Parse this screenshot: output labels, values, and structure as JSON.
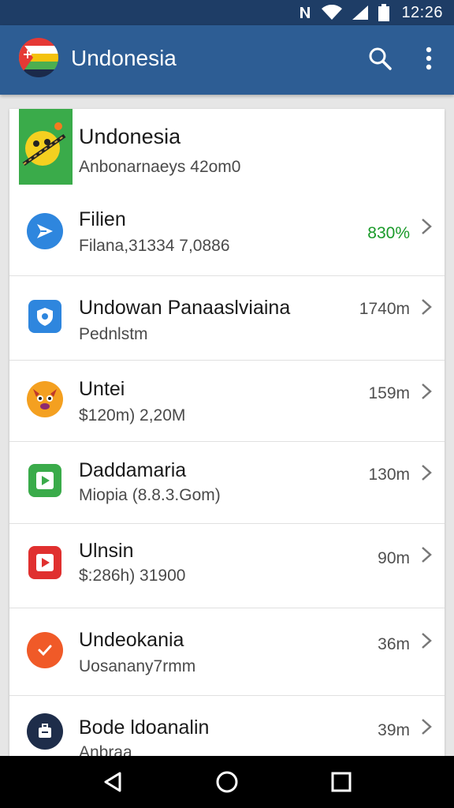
{
  "status_bar": {
    "time": "12:26",
    "icons": [
      "nfc-icon",
      "wifi-icon",
      "signal-icon",
      "battery-icon"
    ]
  },
  "app_bar": {
    "title": "Undonesia",
    "logo_icon": "flag-logo-icon",
    "actions": [
      "search-icon",
      "more-vert-icon"
    ]
  },
  "header": {
    "title": "Undonesia",
    "subtitle": "Anbonarnaeys 42om0"
  },
  "rows": [
    {
      "title": "Filien",
      "subtitle": "Filana,31334 7,0886",
      "value": "830%",
      "icon": "send-icon",
      "icon_color": "#2e86de"
    },
    {
      "title": "Undowan Panaaslviaina",
      "subtitle": "Pednlstm",
      "value": "1740m",
      "icon": "shield-icon",
      "icon_color": "#2e86de"
    },
    {
      "title": "Untei",
      "subtitle": "$120m) 2,20M",
      "value": "159m",
      "icon": "mascot-icon",
      "icon_color": "#f4a020"
    },
    {
      "title": "Daddamaria",
      "subtitle": "Miopia (8.8.3.Gom)",
      "value": "130m",
      "icon": "play-square-icon",
      "icon_color": "#3aab4a"
    },
    {
      "title": "Ulnsin",
      "subtitle": "$:286h) 31900",
      "value": "90m",
      "icon": "play-red-icon",
      "icon_color": "#e0302f"
    },
    {
      "title": "Undeokania",
      "subtitle": "Uosanany7rmm",
      "value": "36m",
      "icon": "check-icon",
      "icon_color": "#f05a28"
    },
    {
      "title": "Bode ldoanalin",
      "subtitle": "Anbraa",
      "value": "39m",
      "icon": "briefcase-icon",
      "icon_color": "#1e2d4a"
    }
  ],
  "nav": [
    "back-icon",
    "home-icon",
    "recents-icon"
  ],
  "colors": {
    "status_bar": "#1e3d66",
    "app_bar": "#2d5d94",
    "accent_green": "#1a9a2a"
  }
}
